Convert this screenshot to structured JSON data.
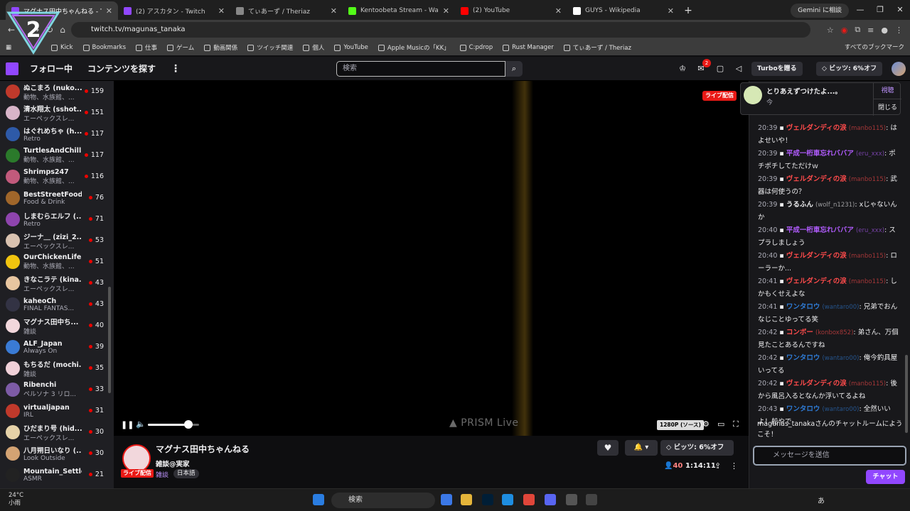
{
  "browser": {
    "tabs": [
      {
        "title": "マグナス田中ちゃんねる - Tw",
        "color": "#9147ff",
        "active": true
      },
      {
        "title": "(2) アスカタン - Twitch",
        "color": "#9147ff",
        "active": false
      },
      {
        "title": "てぃあーず / Theriaz",
        "color": "#888888",
        "active": false
      },
      {
        "title": "Kentoobeta Stream - Watch Liv",
        "color": "#53fc18",
        "active": false
      },
      {
        "title": "(2) YouTube",
        "color": "#ff0000",
        "active": false
      },
      {
        "title": "GUYS - Wikipedia",
        "color": "#ffffff",
        "active": false
      }
    ],
    "gemini_label": "Gemini に相談",
    "url": "twitch.tv/magunas_tanaka",
    "bookmarks": [
      "Kick",
      "Bookmarks",
      "仕事",
      "ゲーム",
      "動画関係",
      "ツイッチ関連",
      "個人",
      "YouTube",
      "Apple Musicの「KK」",
      "C:pdrop",
      "Rust Manager",
      "てぃあーず / Theriaz"
    ],
    "all_bookmarks": "すべてのブックマーク"
  },
  "twitch": {
    "nav_following": "フォロー中",
    "nav_browse": "コンテンツを探す",
    "search_placeholder": "検索",
    "notif_count": "2",
    "turbo": "Turboを贈る",
    "bits": "ビッツ: 6%オフ"
  },
  "sidebar": [
    {
      "name": "ぬこまろ (nuko...",
      "cat": "動物、水族館、...",
      "viewers": "159",
      "color": "#c0392b"
    },
    {
      "name": "清水翔太 (sshot...",
      "cat": "エーペックスレ...",
      "viewers": "151",
      "color": "#d8b4c8"
    },
    {
      "name": "はぐれめちゃ (h...",
      "cat": "Retro",
      "viewers": "117",
      "color": "#2e5aa8"
    },
    {
      "name": "TurtlesAndChill",
      "cat": "動物、水族館、...",
      "viewers": "117",
      "color": "#2b7a2b"
    },
    {
      "name": "Shrimps247",
      "cat": "動物、水族館、...",
      "viewers": "116",
      "color": "#c25a7c"
    },
    {
      "name": "BestStreetFood",
      "cat": "Food & Drink",
      "viewers": "76",
      "color": "#a0662a"
    },
    {
      "name": "しまむらエルフ (...",
      "cat": "Retro",
      "viewers": "71",
      "color": "#8e44ad"
    },
    {
      "name": "ジーナ＿ (zizi_2...",
      "cat": "エーペックスレ...",
      "viewers": "53",
      "color": "#d9c2b0"
    },
    {
      "name": "OurChickenLife",
      "cat": "動物、水族館、...",
      "viewers": "51",
      "color": "#f1c40f"
    },
    {
      "name": "きなこラテ (kina...",
      "cat": "エーペックスレ...",
      "viewers": "43",
      "color": "#e8c6a0"
    },
    {
      "name": "kaheoCh",
      "cat": "FINAL FANTAS...",
      "viewers": "43",
      "color": "#333344"
    },
    {
      "name": "マグナス田中ち...",
      "cat": "雑談",
      "viewers": "40",
      "color": "#f2d7dc"
    },
    {
      "name": "ALF_Japan",
      "cat": "Always On",
      "viewers": "39",
      "color": "#3a7bd5"
    },
    {
      "name": "もちるだ (mochi...",
      "cat": "雑談",
      "viewers": "35",
      "color": "#f0d0d8"
    },
    {
      "name": "Ribenchi",
      "cat": "ペルソナ 3 リロ...",
      "viewers": "33",
      "color": "#7d5ba6"
    },
    {
      "name": "virtualjapan",
      "cat": "IRL",
      "viewers": "31",
      "color": "#c0392b"
    },
    {
      "name": "ひだまり号 (hid...",
      "cat": "エーペックスレ...",
      "viewers": "30",
      "color": "#e6d2a8"
    },
    {
      "name": "八月朔日いなり (...",
      "cat": "Look Outside",
      "viewers": "30",
      "color": "#d4a373"
    },
    {
      "name": "Mountain_Settler",
      "cat": "ASMR",
      "viewers": "21",
      "color": "#222222"
    }
  ],
  "player": {
    "live_label": "ライブ配信",
    "watermark": "PRISM Live",
    "quality": "1280P (ソース)",
    "volume_level": 0.72
  },
  "stream": {
    "channel": "マグナス田中ちゃんねる",
    "title": "雑談@実家",
    "category": "雑談",
    "tag": "日本語",
    "live_label": "ライブ配信",
    "viewers": "40",
    "uptime": "1:14:11",
    "bits": "ビッツ: 6%オフ"
  },
  "popup": {
    "text": "とりあえずつけたよ...。",
    "sub": "今",
    "watch": "視聴",
    "close": "閉じる"
  },
  "chat": [
    {
      "time": "20:39",
      "user": "ヴェルダンディの涙",
      "login": "(manbo115)",
      "color": "#ff4b4b",
      "text": ": はよせいや！"
    },
    {
      "time": "20:39",
      "user": "平成一桁車忘れババア",
      "login": "(eru_xxx)",
      "color": "#b25cff",
      "text": ": ポチポチしてただけｗ"
    },
    {
      "time": "20:39",
      "user": "ヴェルダンディの涙",
      "login": "(manbo115)",
      "color": "#ff4b4b",
      "text": ": 武器は何使うの？"
    },
    {
      "time": "20:39",
      "user": "うるふん",
      "login": "(wolf_n1231)",
      "color": "#efeff1",
      "text": ": xじゃないんか"
    },
    {
      "time": "20:40",
      "user": "平成一桁車忘れババア",
      "login": "(eru_xxx)",
      "color": "#b25cff",
      "text": ": スプラしましょう"
    },
    {
      "time": "20:40",
      "user": "ヴェルダンディの涙",
      "login": "(manbo115)",
      "color": "#ff4b4b",
      "text": ": ローラーか..."
    },
    {
      "time": "20:41",
      "user": "ヴェルダンディの涙",
      "login": "(manbo115)",
      "color": "#ff4b4b",
      "text": ": しかもくせえよな"
    },
    {
      "time": "20:41",
      "user": "ワンタロウ",
      "login": "(wantaro00)",
      "color": "#2e7bd6",
      "text": ": 兄弟でおんなじことゆってる笑"
    },
    {
      "time": "20:42",
      "user": "コンボー",
      "login": "(konbox852)",
      "color": "#ff4b4b",
      "text": ": 弟さん、万個見たことあるんですね"
    },
    {
      "time": "20:42",
      "user": "ワンタロウ",
      "login": "(wantaro00)",
      "color": "#2e7bd6",
      "text": ": 俺今釣具屋いってる"
    },
    {
      "time": "20:42",
      "user": "ヴェルダンディの涙",
      "login": "(manbo115)",
      "color": "#ff4b4b",
      "text": ": 後から風呂入るとなんか浮いてるよね"
    },
    {
      "time": "20:43",
      "user": "ワンタロウ",
      "login": "(wantaro00)",
      "color": "#2e7bd6",
      "text": ": 全然いいよ！船やで"
    }
  ],
  "chat_welcome": "magunas_tanakaさんのチャットルームにようこそ！",
  "chat_placeholder": "メッセージを送信",
  "chat_button": "チャット",
  "taskbar": {
    "temp": "24°C",
    "weather": "小雨",
    "search": "検索",
    "ime": "あ"
  }
}
